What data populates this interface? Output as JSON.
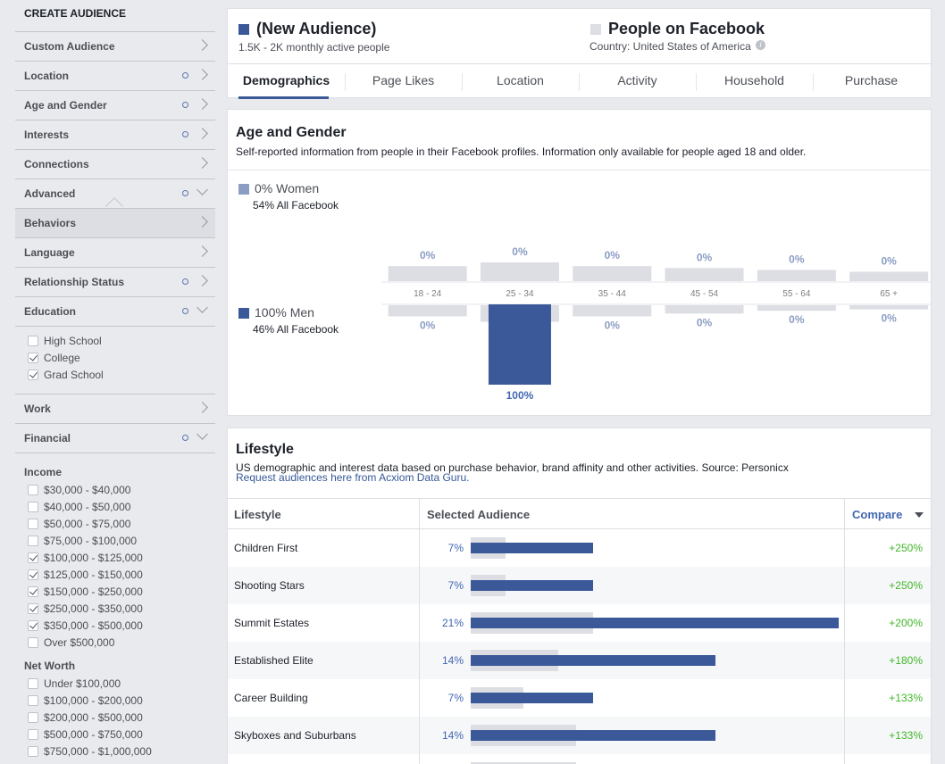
{
  "sidebar": {
    "title": "CREATE AUDIENCE",
    "rows": [
      {
        "label": "Custom Audience",
        "dot": false,
        "chev": "right"
      },
      {
        "label": "Location",
        "dot": true,
        "chev": "right"
      },
      {
        "label": "Age and Gender",
        "dot": true,
        "chev": "right"
      },
      {
        "label": "Interests",
        "dot": true,
        "chev": "right"
      },
      {
        "label": "Connections",
        "dot": false,
        "chev": "right"
      },
      {
        "label": "Advanced",
        "dot": true,
        "chev": "down"
      },
      {
        "label": "Behaviors",
        "dot": false,
        "chev": "right"
      },
      {
        "label": "Language",
        "dot": false,
        "chev": "right"
      },
      {
        "label": "Relationship Status",
        "dot": true,
        "chev": "right"
      },
      {
        "label": "Education",
        "dot": true,
        "chev": "down"
      }
    ],
    "education_options": [
      {
        "label": "High School",
        "checked": false
      },
      {
        "label": "College",
        "checked": true
      },
      {
        "label": "Grad School",
        "checked": true
      }
    ],
    "work_label": "Work",
    "financial_label": "Financial",
    "income_label": "Income",
    "income_options": [
      {
        "label": "$30,000 - $40,000",
        "checked": false
      },
      {
        "label": "$40,000 - $50,000",
        "checked": false
      },
      {
        "label": "$50,000 - $75,000",
        "checked": false
      },
      {
        "label": "$75,000 - $100,000",
        "checked": false
      },
      {
        "label": "$100,000 - $125,000",
        "checked": true
      },
      {
        "label": "$125,000 - $150,000",
        "checked": true
      },
      {
        "label": "$150,000 - $250,000",
        "checked": true
      },
      {
        "label": "$250,000 - $350,000",
        "checked": true
      },
      {
        "label": "$350,000 - $500,000",
        "checked": true
      },
      {
        "label": "Over $500,000",
        "checked": false
      }
    ],
    "networth_label": "Net Worth",
    "networth_options": [
      {
        "label": "Under $100,000",
        "checked": false
      },
      {
        "label": "$100,000 - $200,000",
        "checked": false
      },
      {
        "label": "$200,000 - $500,000",
        "checked": false
      },
      {
        "label": "$500,000 - $750,000",
        "checked": false
      },
      {
        "label": "$750,000 - $1,000,000",
        "checked": false
      }
    ]
  },
  "header": {
    "audience_title": "(New Audience)",
    "audience_sub": "1.5K - 2K monthly active people",
    "facebook_title": "People on Facebook",
    "facebook_sub": "Country: United States of America",
    "info_icon": "i",
    "audience_color": "#3b5998",
    "facebook_color": "#dcdee3",
    "tabs": [
      "Demographics",
      "Page Likes",
      "Location",
      "Activity",
      "Household",
      "Purchase"
    ],
    "active_tab": 0
  },
  "age_gender": {
    "title": "Age and Gender",
    "description": "Self-reported information from people in their Facebook profiles. Information only available for people aged 18 and older.",
    "women_label": "0% Women",
    "women_sub": "54% All Facebook",
    "men_label": "100% Men",
    "men_sub": "46% All Facebook",
    "women_color": "#8b9dc3",
    "men_color": "#3b5998",
    "baseline_color": "#dcdee3",
    "chart_data": {
      "type": "bar",
      "categories": [
        "18 - 24",
        "25 - 34",
        "35 - 44",
        "45 - 54",
        "55 - 64",
        "65 +"
      ],
      "series": [
        {
          "name": "Women",
          "audience": [
            0,
            0,
            0,
            0,
            0,
            0
          ],
          "audience_labels": [
            "0%",
            "0%",
            "0%",
            "0%",
            "0%",
            "0%"
          ],
          "facebook": [
            8,
            10,
            8,
            7,
            6,
            5
          ]
        },
        {
          "name": "Men",
          "audience": [
            0,
            100,
            0,
            0,
            0,
            0
          ],
          "audience_labels": [
            "0%",
            "100%",
            "0%",
            "0%",
            "0%",
            "0%"
          ],
          "facebook": [
            8,
            12,
            8,
            6,
            4,
            3
          ]
        }
      ]
    }
  },
  "lifestyle": {
    "title": "Lifestyle",
    "description": "US demographic and interest data based on purchase behavior, brand affinity and other activities. Source: Personicx",
    "link": "Request audiences here from Acxiom Data Guru.",
    "columns": [
      "Lifestyle",
      "Selected Audience",
      "Compare"
    ],
    "rows": [
      {
        "name": "Children First",
        "pct": "7%",
        "audience": 7,
        "facebook": 2,
        "compare": "+250%"
      },
      {
        "name": "Shooting Stars",
        "pct": "7%",
        "audience": 7,
        "facebook": 2,
        "compare": "+250%"
      },
      {
        "name": "Summit Estates",
        "pct": "21%",
        "audience": 21,
        "facebook": 7,
        "compare": "+200%"
      },
      {
        "name": "Established Elite",
        "pct": "14%",
        "audience": 14,
        "facebook": 5,
        "compare": "+180%"
      },
      {
        "name": "Career Building",
        "pct": "7%",
        "audience": 7,
        "facebook": 3,
        "compare": "+133%"
      },
      {
        "name": "Skyboxes and Suburbans",
        "pct": "14%",
        "audience": 14,
        "facebook": 6,
        "compare": "+133%"
      },
      {
        "name": "",
        "pct": "",
        "audience": 0,
        "facebook": 6,
        "compare": ""
      }
    ]
  }
}
